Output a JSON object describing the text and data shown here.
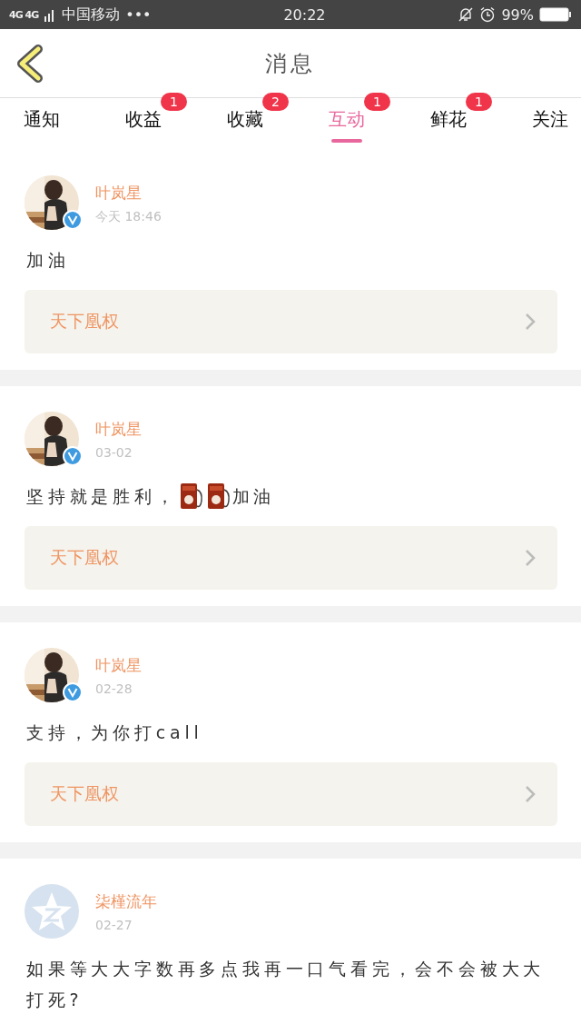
{
  "status_bar": {
    "network": "4G 4G",
    "carrier": "中国移动",
    "more": "•••",
    "time": "20:22",
    "battery": "99%"
  },
  "header": {
    "title": "消息"
  },
  "tabs": [
    {
      "label": "通知",
      "selected": false
    },
    {
      "label": "收益",
      "selected": false,
      "badge": "1"
    },
    {
      "label": "收藏",
      "selected": false,
      "badge": "2"
    },
    {
      "label": "互动",
      "selected": true,
      "badge": "1"
    },
    {
      "label": "鲜花",
      "selected": false,
      "badge": "1"
    },
    {
      "label": "关注",
      "selected": false
    }
  ],
  "messages": [
    {
      "photo": true,
      "verified": true,
      "name": "叶岚星",
      "time": "今天 18:46",
      "body": [
        {
          "kind": "text",
          "text": "加油"
        }
      ],
      "book": "天下凰权"
    },
    {
      "photo": true,
      "verified": true,
      "name": "叶岚星",
      "time": "03-02",
      "body": [
        {
          "kind": "text",
          "text": "坚持就是胜利，"
        },
        {
          "kind": "emoji"
        },
        {
          "kind": "emoji"
        },
        {
          "kind": "text",
          "text": "加油"
        }
      ],
      "book": "天下凰权"
    },
    {
      "photo": true,
      "verified": true,
      "name": "叶岚星",
      "time": "02-28",
      "body": [
        {
          "kind": "text",
          "text": "支持，为你打call"
        }
      ],
      "book": "天下凰权"
    },
    {
      "photo": false,
      "verified": false,
      "name": "柒槿流年",
      "time": "02-27",
      "body": [
        {
          "kind": "text",
          "text": "如果等大大字数再多点我再一口气看完，会不会被大大打死?"
        }
      ]
    }
  ]
}
